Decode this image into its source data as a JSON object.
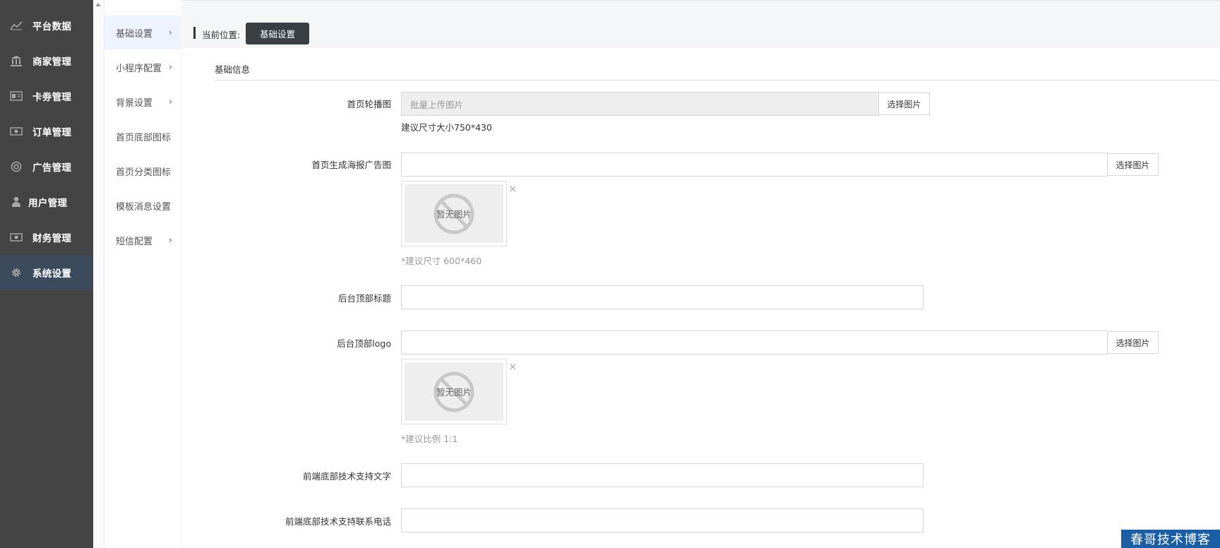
{
  "sidebar": {
    "items": [
      {
        "label": "平台数据",
        "icon": "line-chart-icon"
      },
      {
        "label": "商家管理",
        "icon": "bank-icon"
      },
      {
        "label": "卡劵管理",
        "icon": "card-icon"
      },
      {
        "label": "订单管理",
        "icon": "money-icon"
      },
      {
        "label": "广告管理",
        "icon": "lifebuoy-icon"
      },
      {
        "label": "用户管理",
        "icon": "user-icon"
      },
      {
        "label": "财务管理",
        "icon": "money-icon"
      },
      {
        "label": "系统设置",
        "icon": "gear-icon",
        "active": true
      }
    ]
  },
  "submenu": {
    "items": [
      {
        "label": "基础设置",
        "chevron": "›",
        "active": true
      },
      {
        "label": "小程序配置",
        "chevron": "›"
      },
      {
        "label": "背景设置",
        "chevron": "›"
      },
      {
        "label": "首页底部图标",
        "chevron": ""
      },
      {
        "label": "首页分类图标",
        "chevron": ""
      },
      {
        "label": "模板消息设置",
        "chevron": ""
      },
      {
        "label": "短信配置",
        "chevron": "›"
      }
    ]
  },
  "breadcrumb": {
    "prefix": "当前位置:",
    "current": "基础设置"
  },
  "section": {
    "title": "基础信息"
  },
  "form": {
    "banner": {
      "label": "首页轮播图",
      "placeholder": "批量上传图片",
      "button": "选择图片",
      "hint": "建议尺寸大小750*430"
    },
    "poster": {
      "label": "首页生成海报广告图",
      "value": "",
      "button": "选择图片",
      "no_image": "暂无图片",
      "close": "×",
      "hint": "*建议尺寸 600*460"
    },
    "admin_title": {
      "label": "后台顶部标题",
      "value": ""
    },
    "admin_logo": {
      "label": "后台顶部logo",
      "value": "",
      "button": "选择图片",
      "no_image": "暂无图片",
      "close": "×",
      "hint": "*建议比例 1:1"
    },
    "support_text": {
      "label": "前端底部技术支持文字",
      "value": ""
    },
    "support_phone": {
      "label": "前端底部技术支持联系电话",
      "value": ""
    }
  },
  "watermark": "春哥技术博客",
  "colors": {
    "sidebar_bg": "#444444",
    "sidebar_active": "#3c4b5c",
    "crumb_btn": "#3a3f44",
    "submenu_active": "#eef4ff"
  }
}
